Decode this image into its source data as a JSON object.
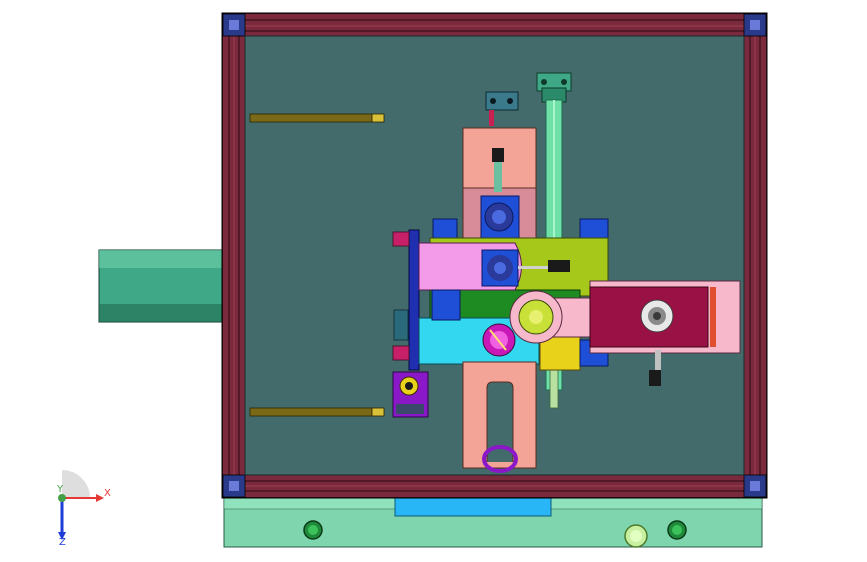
{
  "viewport": {
    "background": "#ffffff",
    "model": "machine-fixture-assembly",
    "view": "top"
  },
  "colors": {
    "frame_rail": "#7a2a3c",
    "frame_dark": "#3a1018",
    "base_panel": "#436b6b",
    "bottom_plate": "#7fd6ae",
    "cylinder": "#3fa886",
    "pink_block": "#f4a497",
    "magenta_block": "#f39be8",
    "cyan_block": "#33d8f0",
    "lime_block": "#a6c81a",
    "dark_green": "#1d8a22",
    "blue_part": "#1f4fd6",
    "yellow_part": "#e8d21a",
    "maroon_block": "#9a1245",
    "light_pink_arm": "#f8b8cc",
    "purple_part": "#8a18c8",
    "rail_rod": "#7a6a18",
    "accent_cyan": "#29b6f6"
  },
  "triad": {
    "x_label": "X",
    "y_label": "Y",
    "z_label": "Z",
    "x_color": "#e53935",
    "y_color": "#43a047",
    "z_color": "#1e3cd8"
  }
}
